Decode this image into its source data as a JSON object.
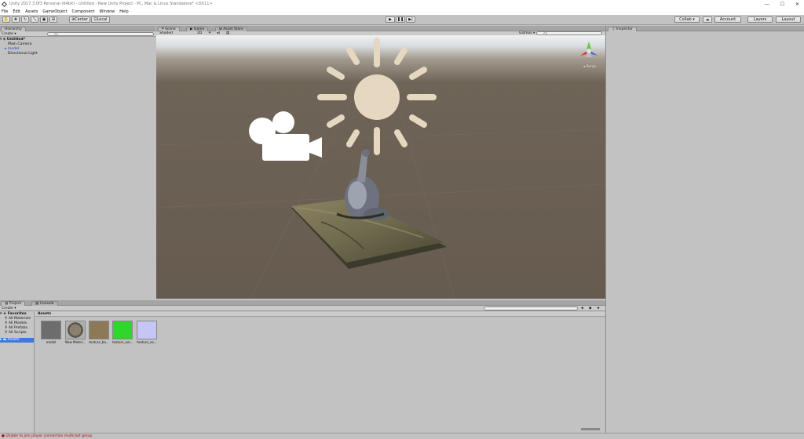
{
  "window": {
    "title": "Unity 2017.3.0f3 Personal (64bit) - Untitled - New Unity Project - PC, Mac & Linux Standalone* <DX11>",
    "minimize": "—",
    "maximize": "☐",
    "close": "✕"
  },
  "menu": [
    "File",
    "Edit",
    "Assets",
    "GameObject",
    "Component",
    "Window",
    "Help"
  ],
  "toolbar": {
    "center": "Center",
    "local": "Local",
    "collab": "Collab ▾",
    "account": "Account",
    "layers": "Layers",
    "layout": "Layout"
  },
  "hierarchy": {
    "tab": "Hierarchy",
    "create": "Create ▾",
    "search_placeholder": "All",
    "scene": "Untitled*",
    "items": [
      "Main Camera",
      "model",
      "Directional Light"
    ]
  },
  "scene_view": {
    "tabs": [
      "Scene",
      "Game",
      "Asset Store"
    ],
    "shading": "Shaded",
    "mode_2d": "2D",
    "gizmos": "Gizmos ▾",
    "search_placeholder": "All",
    "persp": "Persp"
  },
  "inspector": {
    "tab": "Inspector"
  },
  "project": {
    "tabs": [
      "Project",
      "Console"
    ],
    "create": "Create ▾",
    "favorites": "Favorites",
    "favorite_items": [
      "All Materials",
      "All Models",
      "All Prefabs",
      "All Scripts"
    ],
    "assets_root": "Assets",
    "breadcrumb": "Assets",
    "assets": [
      {
        "name": "model",
        "color": "#6d6d6d"
      },
      {
        "name": "New Materi...",
        "color": "#5c5648"
      },
      {
        "name": "texture_ba...",
        "color": "#8c7a56"
      },
      {
        "name": "texture_nor...",
        "color": "#2fd62c"
      },
      {
        "name": "texture_no...",
        "color": "#c6c6f6"
      }
    ]
  },
  "status": {
    "message": "Unable to join player connection multicast group."
  },
  "colors": {
    "sun": "#e6d8c0",
    "camera": "#ffffff"
  }
}
